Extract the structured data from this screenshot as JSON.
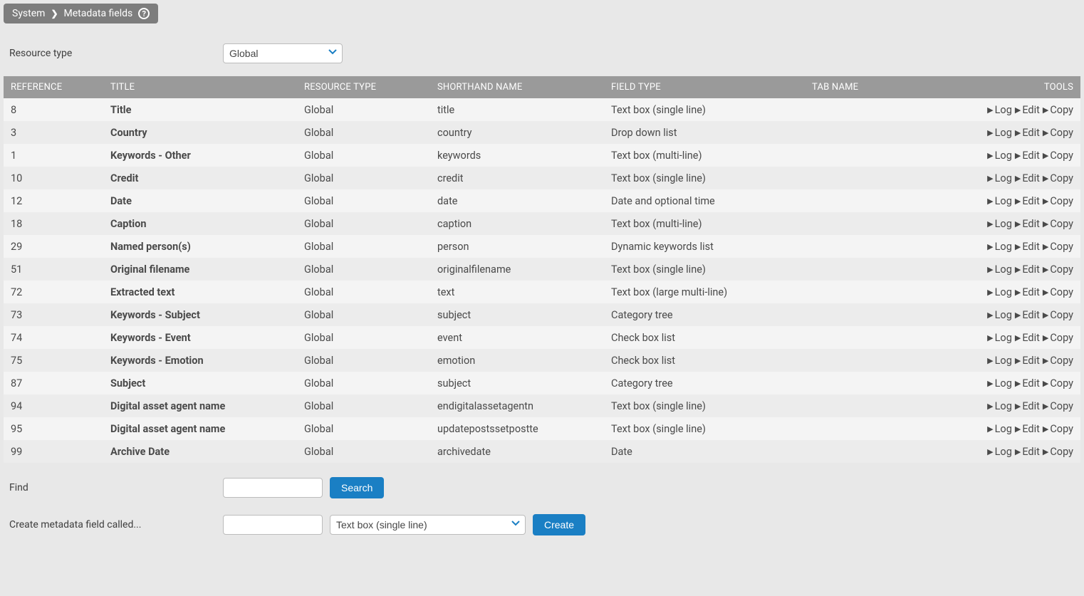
{
  "breadcrumb": {
    "system": "System",
    "page": "Metadata fields"
  },
  "filter": {
    "label": "Resource type",
    "value": "Global"
  },
  "columns": {
    "reference": "REFERENCE",
    "title": "TITLE",
    "resource_type": "RESOURCE TYPE",
    "shorthand": "SHORTHAND NAME",
    "field_type": "FIELD TYPE",
    "tab_name": "TAB NAME",
    "tools": "TOOLS"
  },
  "tool_labels": {
    "log": "Log",
    "edit": "Edit",
    "copy": "Copy"
  },
  "rows": [
    {
      "ref": "8",
      "title": "Title",
      "rtype": "Global",
      "short": "title",
      "ftype": "Text box (single line)",
      "tab": ""
    },
    {
      "ref": "3",
      "title": "Country",
      "rtype": "Global",
      "short": "country",
      "ftype": "Drop down list",
      "tab": ""
    },
    {
      "ref": "1",
      "title": "Keywords - Other",
      "rtype": "Global",
      "short": "keywords",
      "ftype": "Text box (multi-line)",
      "tab": ""
    },
    {
      "ref": "10",
      "title": "Credit",
      "rtype": "Global",
      "short": "credit",
      "ftype": "Text box (single line)",
      "tab": ""
    },
    {
      "ref": "12",
      "title": "Date",
      "rtype": "Global",
      "short": "date",
      "ftype": "Date and optional time",
      "tab": ""
    },
    {
      "ref": "18",
      "title": "Caption",
      "rtype": "Global",
      "short": "caption",
      "ftype": "Text box (multi-line)",
      "tab": ""
    },
    {
      "ref": "29",
      "title": "Named person(s)",
      "rtype": "Global",
      "short": "person",
      "ftype": "Dynamic keywords list",
      "tab": ""
    },
    {
      "ref": "51",
      "title": "Original filename",
      "rtype": "Global",
      "short": "originalfilename",
      "ftype": "Text box (single line)",
      "tab": ""
    },
    {
      "ref": "72",
      "title": "Extracted text",
      "rtype": "Global",
      "short": "text",
      "ftype": "Text box (large multi-line)",
      "tab": ""
    },
    {
      "ref": "73",
      "title": "Keywords - Subject",
      "rtype": "Global",
      "short": "subject",
      "ftype": "Category tree",
      "tab": ""
    },
    {
      "ref": "74",
      "title": "Keywords - Event",
      "rtype": "Global",
      "short": "event",
      "ftype": "Check box list",
      "tab": ""
    },
    {
      "ref": "75",
      "title": "Keywords - Emotion",
      "rtype": "Global",
      "short": "emotion",
      "ftype": "Check box list",
      "tab": ""
    },
    {
      "ref": "87",
      "title": "Subject",
      "rtype": "Global",
      "short": "subject",
      "ftype": "Category tree",
      "tab": ""
    },
    {
      "ref": "94",
      "title": "Digital asset agent name",
      "rtype": "Global",
      "short": "endigitalassetagentn",
      "ftype": "Text box (single line)",
      "tab": ""
    },
    {
      "ref": "95",
      "title": "Digital asset agent name",
      "rtype": "Global",
      "short": "updatepostssetpostte",
      "ftype": "Text box (single line)",
      "tab": ""
    },
    {
      "ref": "99",
      "title": "Archive Date",
      "rtype": "Global",
      "short": "archivedate",
      "ftype": "Date",
      "tab": ""
    }
  ],
  "find": {
    "label": "Find",
    "button": "Search"
  },
  "create": {
    "label": "Create metadata field called...",
    "type_value": "Text box (single line)",
    "button": "Create"
  }
}
